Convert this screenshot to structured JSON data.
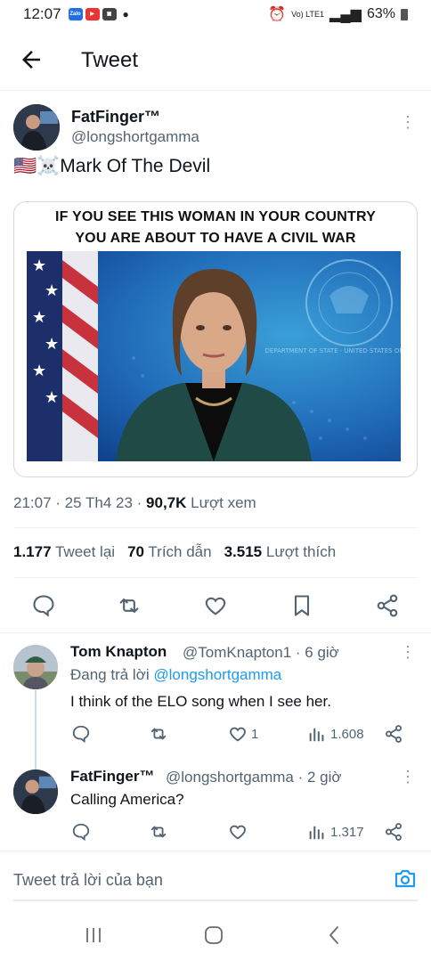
{
  "status_bar": {
    "time": "12:07",
    "app_icons": [
      "Zalo",
      "YouTube",
      "Gallery"
    ],
    "battery": "63%",
    "network": "Vo) LTE1"
  },
  "header": {
    "title": "Tweet"
  },
  "tweet": {
    "display_name": "FatFinger™",
    "handle": "@longshortgamma",
    "text": "🇺🇸☠️Mark Of The Devil",
    "image_caption_line1": "IF YOU SEE THIS WOMAN IN YOUR COUNTRY",
    "image_caption_line2": "YOU ARE ABOUT TO HAVE A CIVIL WAR",
    "seal_text": "DEPARTMENT OF STATE · UNITED STATES OF AMERICA",
    "time": "21:07 · 25 Th4 23 ·",
    "views_count": "90,7K",
    "views_label": "Lượt xem",
    "retweets_count": "1.177",
    "retweets_label": "Tweet lại",
    "quotes_count": "70",
    "quotes_label": "Trích dẫn",
    "likes_count": "3.515",
    "likes_label": "Lượt thích"
  },
  "replies": [
    {
      "display_name": "Tom Knapton",
      "meta": "@TomKnapton1 · 6 giờ",
      "replying_prefix": "Đang trả lời",
      "replying_handle": "@longshortgamma",
      "text": "I think of the ELO song when I see her.",
      "likes": "1",
      "views": "1.608"
    },
    {
      "display_name": "FatFinger™",
      "meta": "@longshortgamma · 2 giờ",
      "text": "Calling America?",
      "likes": "",
      "views": "1.317"
    }
  ],
  "composer": {
    "placeholder": "Tweet trả lời của bạn"
  },
  "colors": {
    "accent": "#1d9bf0",
    "text": "#0f1419",
    "muted": "#536471",
    "border": "#eff3f4"
  }
}
